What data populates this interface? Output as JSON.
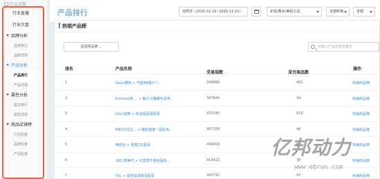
{
  "sidebar": {
    "header": "行业洞察",
    "top_items": [
      "行业直播",
      "行业大盘"
    ],
    "sections": [
      {
        "label": "品牌分析",
        "active": false,
        "children": [
          "品牌排行",
          "品牌详情"
        ]
      },
      {
        "label": "产品分析",
        "active": true,
        "children": [
          "产品排行",
          "产品详情"
        ],
        "active_child": 0
      },
      {
        "label": "属性分析",
        "active": false,
        "children": [
          "属性排行",
          "属性详情"
        ]
      },
      {
        "label": "商品店铺榜",
        "active": false,
        "children": [
          "行业粒度",
          "品牌粒度",
          "产品粒度"
        ]
      }
    ]
  },
  "header": {
    "title": "产品排行",
    "date_range": "自然日（2015-11-11~2015-11-11）",
    "category": "彩妆/香水/美妆工具",
    "channel": "全部终端",
    "scope": "全网"
  },
  "panel": {
    "title": "热销产品榜",
    "filter_select": "请选择品牌",
    "search_placeholder": "请输入产品名称关键字"
  },
  "table": {
    "columns": [
      "排名",
      "产品名称",
      "交易指数",
      "支付商品数",
      "操作"
    ],
    "sort_mark": "⇕",
    "rows": [
      {
        "rank": "1",
        "name": "Nars/娜斯 + 气垫BB霜0??...",
        "index": "599866",
        "count": "401",
        "action": "热销商品榜"
      },
      {
        "rank": "2",
        "name": "Rimmel/芮 ... + 魅力闪耀睫毛膏罗...",
        "index": "567845",
        "count": "34",
        "action": "热销商品榜"
      },
      {
        "rank": "3",
        "name": "Dior/迪奥 + 粉漾唇膏润唇膏",
        "index": "475345",
        "count": "610",
        "action": "热销商品榜"
      },
      {
        "rank": "4",
        "name": "MAYU/玛尤... + 眼影盘第一副彩色...",
        "index": "457100",
        "count": "46",
        "action": "热销商品榜"
      },
      {
        "rank": "5",
        "name": "美颜丝 + 唇蜜2次唇膏",
        "index": "449919",
        "count": "8",
        "action": "热销商品榜"
      },
      {
        "rank": "6",
        "name": "3NC/德美时 + 红蓝雪不脱色唇色...",
        "index": "419422",
        "count": "38",
        "action": "热销商品榜"
      },
      {
        "rank": "7",
        "name": "YSL + 圆管滋润保湿唇膏",
        "index": "405742",
        "count": "97",
        "action": "热销商品榜"
      }
    ]
  },
  "watermark": {
    "brand": "亿邦动力",
    "url": "www.ebrun.com"
  }
}
